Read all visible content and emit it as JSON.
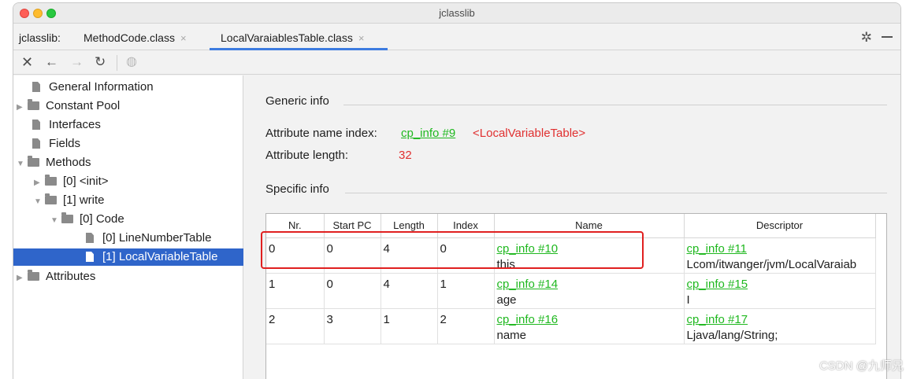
{
  "window": {
    "title": "jclasslib"
  },
  "tabbar": {
    "prefix": "jclasslib:",
    "tabs": [
      {
        "label": "MethodCode.class",
        "active": false
      },
      {
        "label": "LocalVaraiablesTable.class",
        "active": true
      }
    ],
    "close_glyph": "×",
    "settings_icon": "gear-icon"
  },
  "toolbar": {
    "icons": [
      "close-icon",
      "back-arrow-icon",
      "forward-arrow-icon",
      "refresh-icon",
      "globe-icon"
    ]
  },
  "tree": {
    "nodes": [
      {
        "label": "General Information"
      },
      {
        "label": "Constant Pool"
      },
      {
        "label": "Interfaces"
      },
      {
        "label": "Fields"
      },
      {
        "label": "Methods"
      },
      {
        "label": "[0] <init>"
      },
      {
        "label": "[1] write"
      },
      {
        "label": "[0] Code"
      },
      {
        "label": "[0] LineNumberTable"
      },
      {
        "label": "[1] LocalVariableTable",
        "selected": true
      },
      {
        "label": "Attributes"
      }
    ]
  },
  "main": {
    "generic_info_label": "Generic info",
    "attr_name_index_label": "Attribute name index:",
    "attr_name_index_link": "cp_info #9",
    "attr_name_index_value": "<LocalVariableTable>",
    "attr_length_label": "Attribute length:",
    "attr_length_value": "32",
    "specific_info_label": "Specific info",
    "table": {
      "headers": [
        "Nr.",
        "Start PC",
        "Length",
        "Index",
        "Name",
        "Descriptor"
      ],
      "rows": [
        {
          "nr": "0",
          "start_pc": "0",
          "length": "4",
          "index": "0",
          "name_link": "cp_info #10",
          "name": "this",
          "desc_link": "cp_info #11",
          "desc": "Lcom/itwanger/jvm/LocalVaraiab"
        },
        {
          "nr": "1",
          "start_pc": "0",
          "length": "4",
          "index": "1",
          "name_link": "cp_info #14",
          "name": "age",
          "desc_link": "cp_info #15",
          "desc": "I"
        },
        {
          "nr": "2",
          "start_pc": "3",
          "length": "1",
          "index": "2",
          "name_link": "cp_info #16",
          "name": "name",
          "desc_link": "cp_info #17",
          "desc": "Ljava/lang/String;"
        }
      ]
    }
  },
  "watermark": "CSDN @九师兄",
  "colors": {
    "link": "#1fb81f",
    "value_red": "#e03030",
    "selection": "#2f65ca",
    "highlight_box": "#e02020",
    "tab_underline": "#3d7be0"
  }
}
